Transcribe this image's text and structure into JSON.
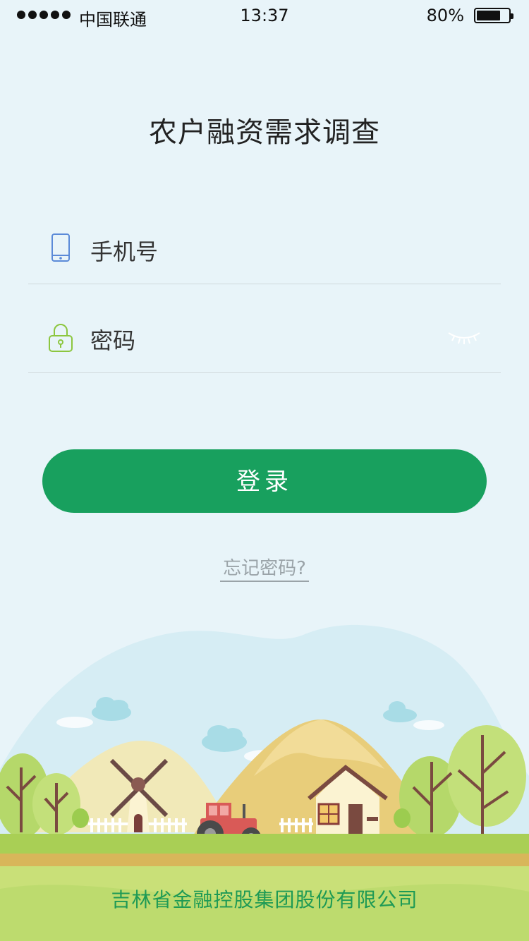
{
  "status_bar": {
    "carrier": "中国联通",
    "time": "13:37",
    "battery_percent": "80%",
    "battery_level": 0.8
  },
  "page": {
    "title": "农户融资需求调查"
  },
  "form": {
    "phone_placeholder": "手机号",
    "password_placeholder": "密码",
    "login_label": "登录",
    "forgot_label": "忘记密码?"
  },
  "footer": {
    "company": "吉林省金融控股集团股份有限公司"
  },
  "colors": {
    "primary_green": "#18a05e",
    "background": "#e8f4f9",
    "phone_icon": "#5b8ad8",
    "lock_icon": "#8cc63f"
  },
  "icons": {
    "phone": "phone-icon",
    "lock": "lock-icon",
    "eye": "eye-closed-icon"
  }
}
